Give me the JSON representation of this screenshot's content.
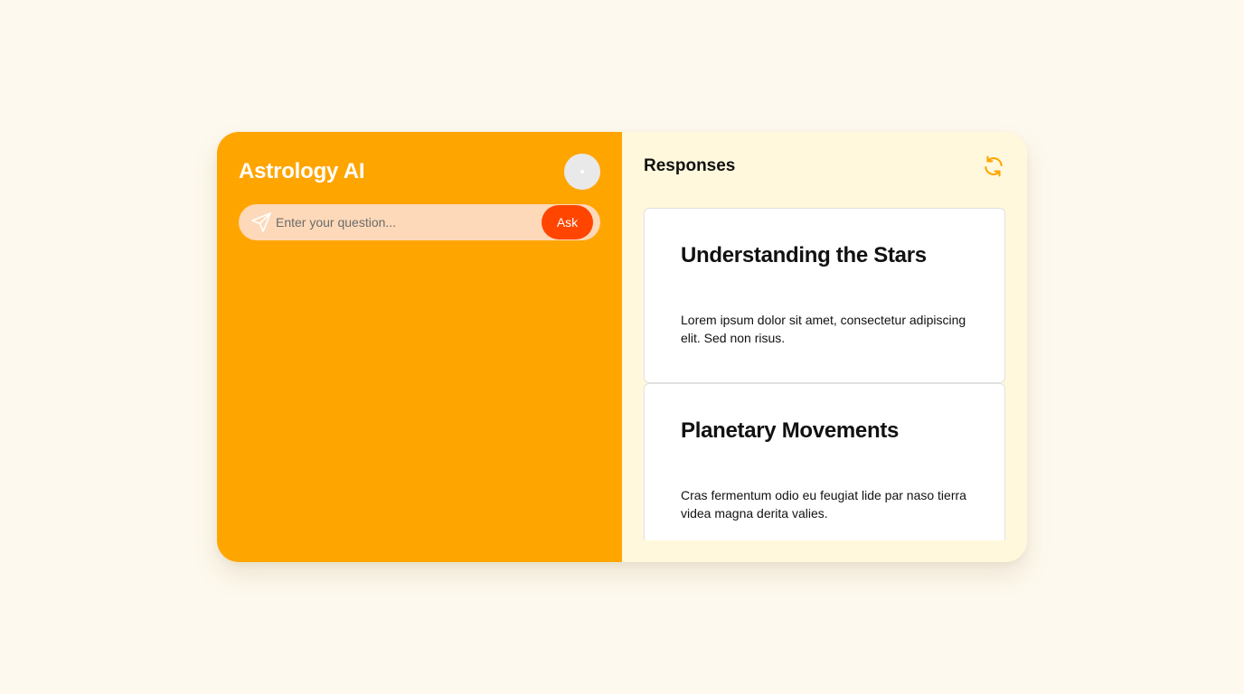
{
  "app": {
    "title": "Astrology AI"
  },
  "ask": {
    "placeholder": "Enter your question...",
    "button_label": "Ask"
  },
  "responses": {
    "title": "Responses",
    "cards": [
      {
        "title": "Understanding the Stars",
        "text": "Lorem ipsum dolor sit amet, consectetur adipiscing elit. Sed non risus."
      },
      {
        "title": "Planetary Movements",
        "text": "Cras fermentum odio eu feugiat lide par naso tierra videa magna derita valies."
      }
    ]
  },
  "icons": {
    "send": "send-icon",
    "refresh": "refresh-icon",
    "avatar": "avatar"
  },
  "colors": {
    "page_background": "#fef9ee",
    "left_panel": "#ffa500",
    "input_background": "#fdd9b9",
    "ask_button": "#ff4500",
    "right_panel": "#fff8dd",
    "refresh_icon": "#ffa500"
  }
}
